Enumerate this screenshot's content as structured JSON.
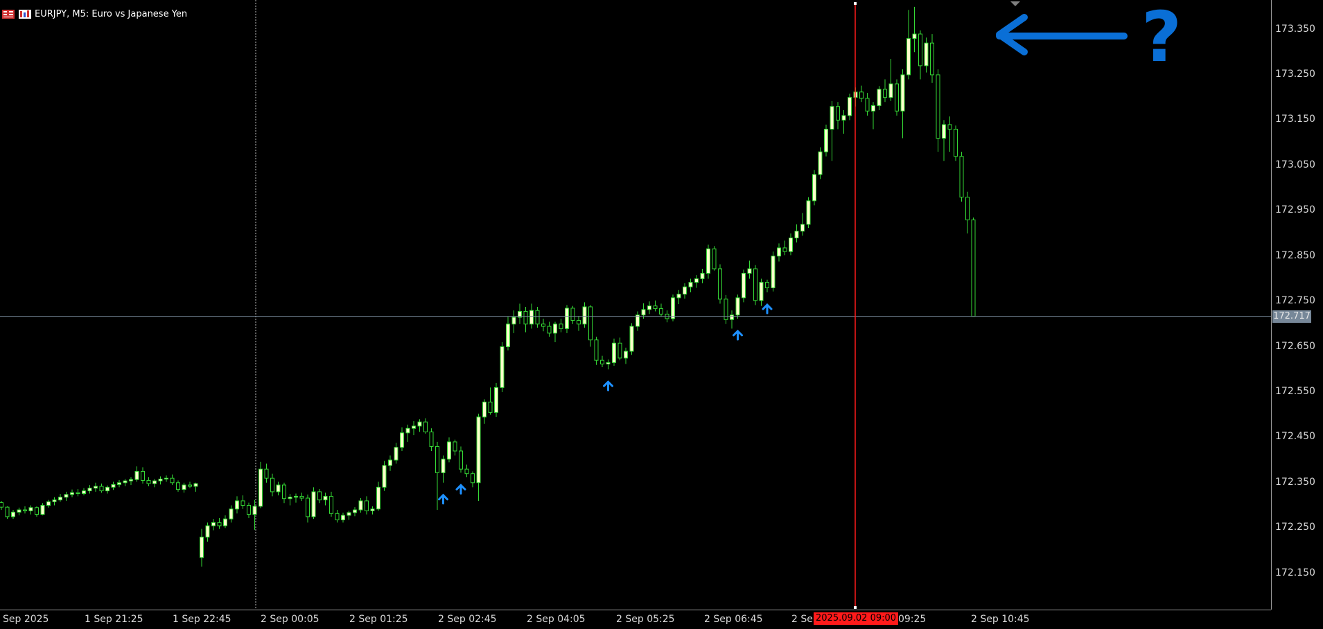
{
  "window": {
    "title": "EURJPY, M5:  Euro vs Japanese Yen",
    "symbol": "EURJPY",
    "timeframe": "M5"
  },
  "colors": {
    "background": "#000000",
    "candle_bull_body": "#ffffcc",
    "candle_bear_body": "#000000",
    "candle_outline": "#35d935",
    "arrow": "#1e90ff",
    "annotation": "#0a6fd6",
    "crosshair_line": "#ff1a1a",
    "bid_line": "#778899"
  },
  "price_axis": {
    "labels": [
      "173.350",
      "173.250",
      "173.150",
      "173.050",
      "172.950",
      "172.850",
      "172.750",
      "172.650",
      "172.550",
      "172.450",
      "172.350",
      "172.250",
      "172.150"
    ],
    "current_price": "172.717"
  },
  "time_axis": {
    "labels": [
      "Sep 2025",
      "1 Sep 21:25",
      "1 Sep 22:45",
      "2 Sep 00:05",
      "2 Sep 01:25",
      "2 Sep 02:45",
      "2 Sep 04:05",
      "2 Sep 05:25",
      "2 Sep 06:45",
      "2 Sep",
      "ep 09:25",
      "2 Sep 10:45"
    ],
    "crosshair_time": "2025.09.02 09:00"
  },
  "annotation": {
    "symbol": "?",
    "arrow_direction": "left"
  },
  "chart_data": {
    "type": "candlestick",
    "ylim": [
      172.07,
      173.415
    ],
    "candles": [
      [
        172.306,
        172.31,
        172.29,
        172.296
      ],
      [
        172.296,
        172.298,
        172.27,
        172.275
      ],
      [
        172.275,
        172.29,
        172.27,
        172.285
      ],
      [
        172.285,
        172.295,
        172.278,
        172.29
      ],
      [
        172.29,
        172.298,
        172.282,
        172.288
      ],
      [
        172.288,
        172.3,
        172.28,
        172.295
      ],
      [
        172.295,
        172.298,
        172.275,
        172.28
      ],
      [
        172.28,
        172.305,
        172.278,
        172.3
      ],
      [
        172.3,
        172.312,
        172.295,
        172.308
      ],
      [
        172.308,
        172.318,
        172.3,
        172.312
      ],
      [
        172.312,
        172.325,
        172.308,
        172.318
      ],
      [
        172.318,
        172.33,
        172.31,
        172.324
      ],
      [
        172.324,
        172.335,
        172.318,
        172.328
      ],
      [
        172.328,
        172.336,
        172.32,
        172.326
      ],
      [
        172.326,
        172.338,
        172.322,
        172.332
      ],
      [
        172.332,
        172.345,
        172.326,
        172.338
      ],
      [
        172.338,
        172.35,
        172.33,
        172.342
      ],
      [
        172.342,
        172.348,
        172.328,
        172.332
      ],
      [
        172.332,
        172.344,
        172.326,
        172.34
      ],
      [
        172.34,
        172.352,
        172.334,
        172.346
      ],
      [
        172.346,
        172.356,
        172.34,
        172.35
      ],
      [
        172.35,
        172.358,
        172.342,
        172.354
      ],
      [
        172.354,
        172.362,
        172.345,
        172.357
      ],
      [
        172.357,
        172.386,
        172.352,
        172.375
      ],
      [
        172.375,
        172.384,
        172.348,
        172.355
      ],
      [
        172.355,
        172.362,
        172.342,
        172.348
      ],
      [
        172.348,
        172.358,
        172.34,
        172.354
      ],
      [
        172.354,
        172.364,
        172.346,
        172.358
      ],
      [
        172.358,
        172.366,
        172.352,
        172.36
      ],
      [
        172.36,
        172.368,
        172.345,
        172.35
      ],
      [
        172.35,
        172.355,
        172.33,
        172.335
      ],
      [
        172.335,
        172.35,
        172.328,
        172.345
      ],
      [
        172.345,
        172.352,
        172.338,
        172.342
      ],
      [
        172.342,
        172.35,
        172.33,
        172.348
      ],
      [
        172.185,
        172.248,
        172.165,
        172.23
      ],
      [
        172.23,
        172.262,
        172.22,
        172.255
      ],
      [
        172.255,
        172.27,
        172.245,
        172.262
      ],
      [
        172.262,
        172.272,
        172.248,
        172.255
      ],
      [
        172.255,
        172.278,
        172.25,
        172.27
      ],
      [
        172.27,
        172.3,
        172.262,
        172.292
      ],
      [
        172.292,
        172.32,
        172.282,
        172.31
      ],
      [
        172.31,
        172.322,
        172.292,
        172.3
      ],
      [
        172.3,
        172.306,
        172.272,
        172.28
      ],
      [
        172.28,
        172.312,
        172.246,
        172.298
      ],
      [
        172.298,
        172.396,
        172.294,
        172.38
      ],
      [
        172.38,
        172.392,
        172.35,
        172.36
      ],
      [
        172.36,
        172.37,
        172.32,
        172.33
      ],
      [
        172.33,
        172.352,
        172.322,
        172.345
      ],
      [
        172.345,
        172.35,
        172.305,
        172.315
      ],
      [
        172.315,
        172.325,
        172.3,
        172.318
      ],
      [
        172.318,
        172.326,
        172.306,
        172.32
      ],
      [
        172.32,
        172.328,
        172.31,
        172.316
      ],
      [
        172.316,
        172.324,
        172.262,
        172.275
      ],
      [
        172.275,
        172.34,
        172.27,
        172.33
      ],
      [
        172.33,
        172.336,
        172.305,
        172.312
      ],
      [
        172.312,
        172.328,
        172.3,
        172.32
      ],
      [
        172.32,
        172.33,
        172.275,
        172.282
      ],
      [
        172.282,
        172.29,
        172.262,
        172.268
      ],
      [
        172.268,
        172.284,
        172.262,
        172.278
      ],
      [
        172.278,
        172.288,
        172.268,
        172.284
      ],
      [
        172.284,
        172.296,
        172.276,
        172.29
      ],
      [
        172.29,
        172.316,
        172.284,
        172.31
      ],
      [
        172.31,
        172.32,
        172.28,
        172.288
      ],
      [
        172.288,
        172.298,
        172.28,
        172.292
      ],
      [
        172.292,
        172.352,
        172.288,
        172.34
      ],
      [
        172.34,
        172.398,
        172.332,
        172.388
      ],
      [
        172.388,
        172.41,
        172.376,
        172.4
      ],
      [
        172.4,
        172.438,
        172.392,
        172.428
      ],
      [
        172.428,
        172.472,
        172.42,
        172.46
      ],
      [
        172.46,
        172.478,
        172.44,
        172.47
      ],
      [
        172.47,
        172.486,
        172.455,
        172.475
      ],
      [
        172.475,
        172.49,
        172.462,
        172.484
      ],
      [
        172.484,
        172.492,
        172.458,
        172.462
      ],
      [
        172.462,
        172.47,
        172.42,
        172.43
      ],
      [
        172.43,
        172.44,
        172.29,
        172.372
      ],
      [
        172.372,
        172.41,
        172.35,
        172.402
      ],
      [
        172.402,
        172.45,
        172.395,
        172.44
      ],
      [
        172.44,
        172.445,
        172.41,
        172.42
      ],
      [
        172.42,
        172.43,
        172.372,
        172.38
      ],
      [
        172.38,
        172.39,
        172.362,
        172.37
      ],
      [
        172.37,
        172.375,
        172.34,
        172.35
      ],
      [
        172.35,
        172.502,
        172.31,
        172.495
      ],
      [
        172.495,
        172.534,
        172.48,
        172.528
      ],
      [
        172.528,
        172.56,
        172.5,
        172.505
      ],
      [
        172.505,
        172.57,
        172.495,
        172.56
      ],
      [
        172.56,
        172.66,
        172.55,
        172.65
      ],
      [
        172.65,
        172.716,
        172.642,
        172.7
      ],
      [
        172.7,
        172.73,
        172.68,
        172.715
      ],
      [
        172.715,
        172.745,
        172.7,
        172.728
      ],
      [
        172.728,
        172.738,
        172.682,
        172.7
      ],
      [
        172.7,
        172.745,
        172.69,
        172.73
      ],
      [
        172.73,
        172.738,
        172.692,
        172.7
      ],
      [
        172.7,
        172.712,
        172.684,
        172.695
      ],
      [
        172.695,
        172.705,
        172.672,
        172.68
      ],
      [
        172.68,
        172.705,
        172.66,
        172.7
      ],
      [
        172.7,
        172.712,
        172.682,
        172.69
      ],
      [
        172.69,
        172.742,
        172.68,
        172.735
      ],
      [
        172.735,
        172.74,
        172.7,
        172.708
      ],
      [
        172.708,
        172.718,
        172.685,
        172.7
      ],
      [
        172.7,
        172.748,
        172.692,
        172.738
      ],
      [
        172.738,
        172.742,
        172.65,
        172.665
      ],
      [
        172.665,
        172.672,
        172.61,
        172.62
      ],
      [
        172.62,
        172.63,
        172.605,
        172.612
      ],
      [
        172.612,
        172.622,
        172.6,
        172.615
      ],
      [
        172.615,
        172.668,
        172.608,
        172.658
      ],
      [
        172.658,
        172.67,
        172.62,
        172.625
      ],
      [
        172.625,
        172.648,
        172.612,
        172.64
      ],
      [
        172.64,
        172.702,
        172.632,
        172.695
      ],
      [
        172.695,
        172.728,
        172.685,
        172.72
      ],
      [
        172.72,
        172.746,
        172.712,
        172.732
      ],
      [
        172.732,
        172.75,
        172.722,
        172.74
      ],
      [
        172.74,
        172.752,
        172.728,
        172.734
      ],
      [
        172.734,
        172.745,
        172.716,
        172.722
      ],
      [
        172.722,
        172.73,
        172.704,
        172.712
      ],
      [
        172.712,
        172.765,
        172.706,
        172.758
      ],
      [
        172.758,
        172.775,
        172.744,
        172.766
      ],
      [
        172.766,
        172.79,
        172.756,
        172.782
      ],
      [
        172.782,
        172.8,
        172.77,
        172.792
      ],
      [
        172.792,
        172.808,
        172.78,
        172.8
      ],
      [
        172.8,
        172.822,
        172.79,
        172.812
      ],
      [
        172.812,
        172.875,
        172.8,
        172.866
      ],
      [
        172.866,
        172.872,
        172.818,
        172.822
      ],
      [
        172.822,
        172.832,
        172.745,
        172.755
      ],
      [
        172.755,
        172.764,
        172.7,
        172.71
      ],
      [
        172.71,
        172.73,
        172.69,
        172.72
      ],
      [
        172.72,
        172.765,
        172.712,
        172.758
      ],
      [
        172.758,
        172.82,
        172.748,
        172.812
      ],
      [
        172.812,
        172.84,
        172.8,
        172.822
      ],
      [
        172.822,
        172.83,
        172.742,
        172.752
      ],
      [
        172.752,
        172.8,
        172.74,
        172.792
      ],
      [
        172.792,
        172.798,
        172.77,
        172.78
      ],
      [
        172.78,
        172.86,
        172.772,
        172.85
      ],
      [
        172.85,
        172.878,
        172.838,
        172.868
      ],
      [
        172.868,
        172.884,
        172.852,
        172.86
      ],
      [
        172.86,
        172.9,
        172.852,
        172.89
      ],
      [
        172.89,
        172.92,
        172.88,
        172.905
      ],
      [
        172.905,
        172.945,
        172.895,
        172.92
      ],
      [
        172.92,
        172.98,
        172.912,
        172.972
      ],
      [
        172.972,
        173.04,
        172.962,
        173.03
      ],
      [
        173.03,
        173.09,
        173.02,
        173.08
      ],
      [
        173.08,
        173.14,
        173.07,
        173.13
      ],
      [
        173.13,
        173.192,
        173.06,
        173.18
      ],
      [
        173.18,
        173.19,
        173.13,
        173.15
      ],
      [
        173.15,
        173.172,
        173.12,
        173.16
      ],
      [
        173.16,
        173.208,
        173.15,
        173.2
      ],
      [
        173.2,
        173.222,
        173.18,
        173.212
      ],
      [
        173.212,
        173.226,
        173.19,
        173.198
      ],
      [
        173.198,
        173.21,
        173.16,
        173.17
      ],
      [
        173.17,
        173.19,
        173.13,
        173.182
      ],
      [
        173.182,
        173.225,
        173.172,
        173.218
      ],
      [
        173.218,
        173.24,
        173.19,
        173.2
      ],
      [
        173.2,
        173.285,
        173.192,
        173.23
      ],
      [
        173.23,
        173.24,
        173.16,
        173.17
      ],
      [
        173.17,
        173.262,
        173.11,
        173.25
      ],
      [
        173.25,
        173.393,
        173.24,
        173.33
      ],
      [
        173.33,
        173.4,
        173.3,
        173.34
      ],
      [
        173.34,
        173.348,
        173.24,
        173.27
      ],
      [
        173.27,
        173.332,
        173.255,
        173.32
      ],
      [
        173.32,
        173.34,
        173.232,
        173.25
      ],
      [
        173.25,
        173.262,
        173.08,
        173.11
      ],
      [
        173.11,
        173.15,
        173.06,
        173.14
      ],
      [
        173.14,
        173.158,
        173.08,
        173.13
      ],
      [
        173.13,
        173.138,
        173.06,
        173.07
      ],
      [
        173.07,
        173.08,
        172.97,
        172.98
      ],
      [
        172.98,
        172.992,
        172.9,
        172.93
      ],
      [
        172.93,
        172.935,
        172.717,
        172.717
      ]
    ],
    "buy_arrows": [
      75,
      78,
      103,
      125,
      130
    ]
  }
}
